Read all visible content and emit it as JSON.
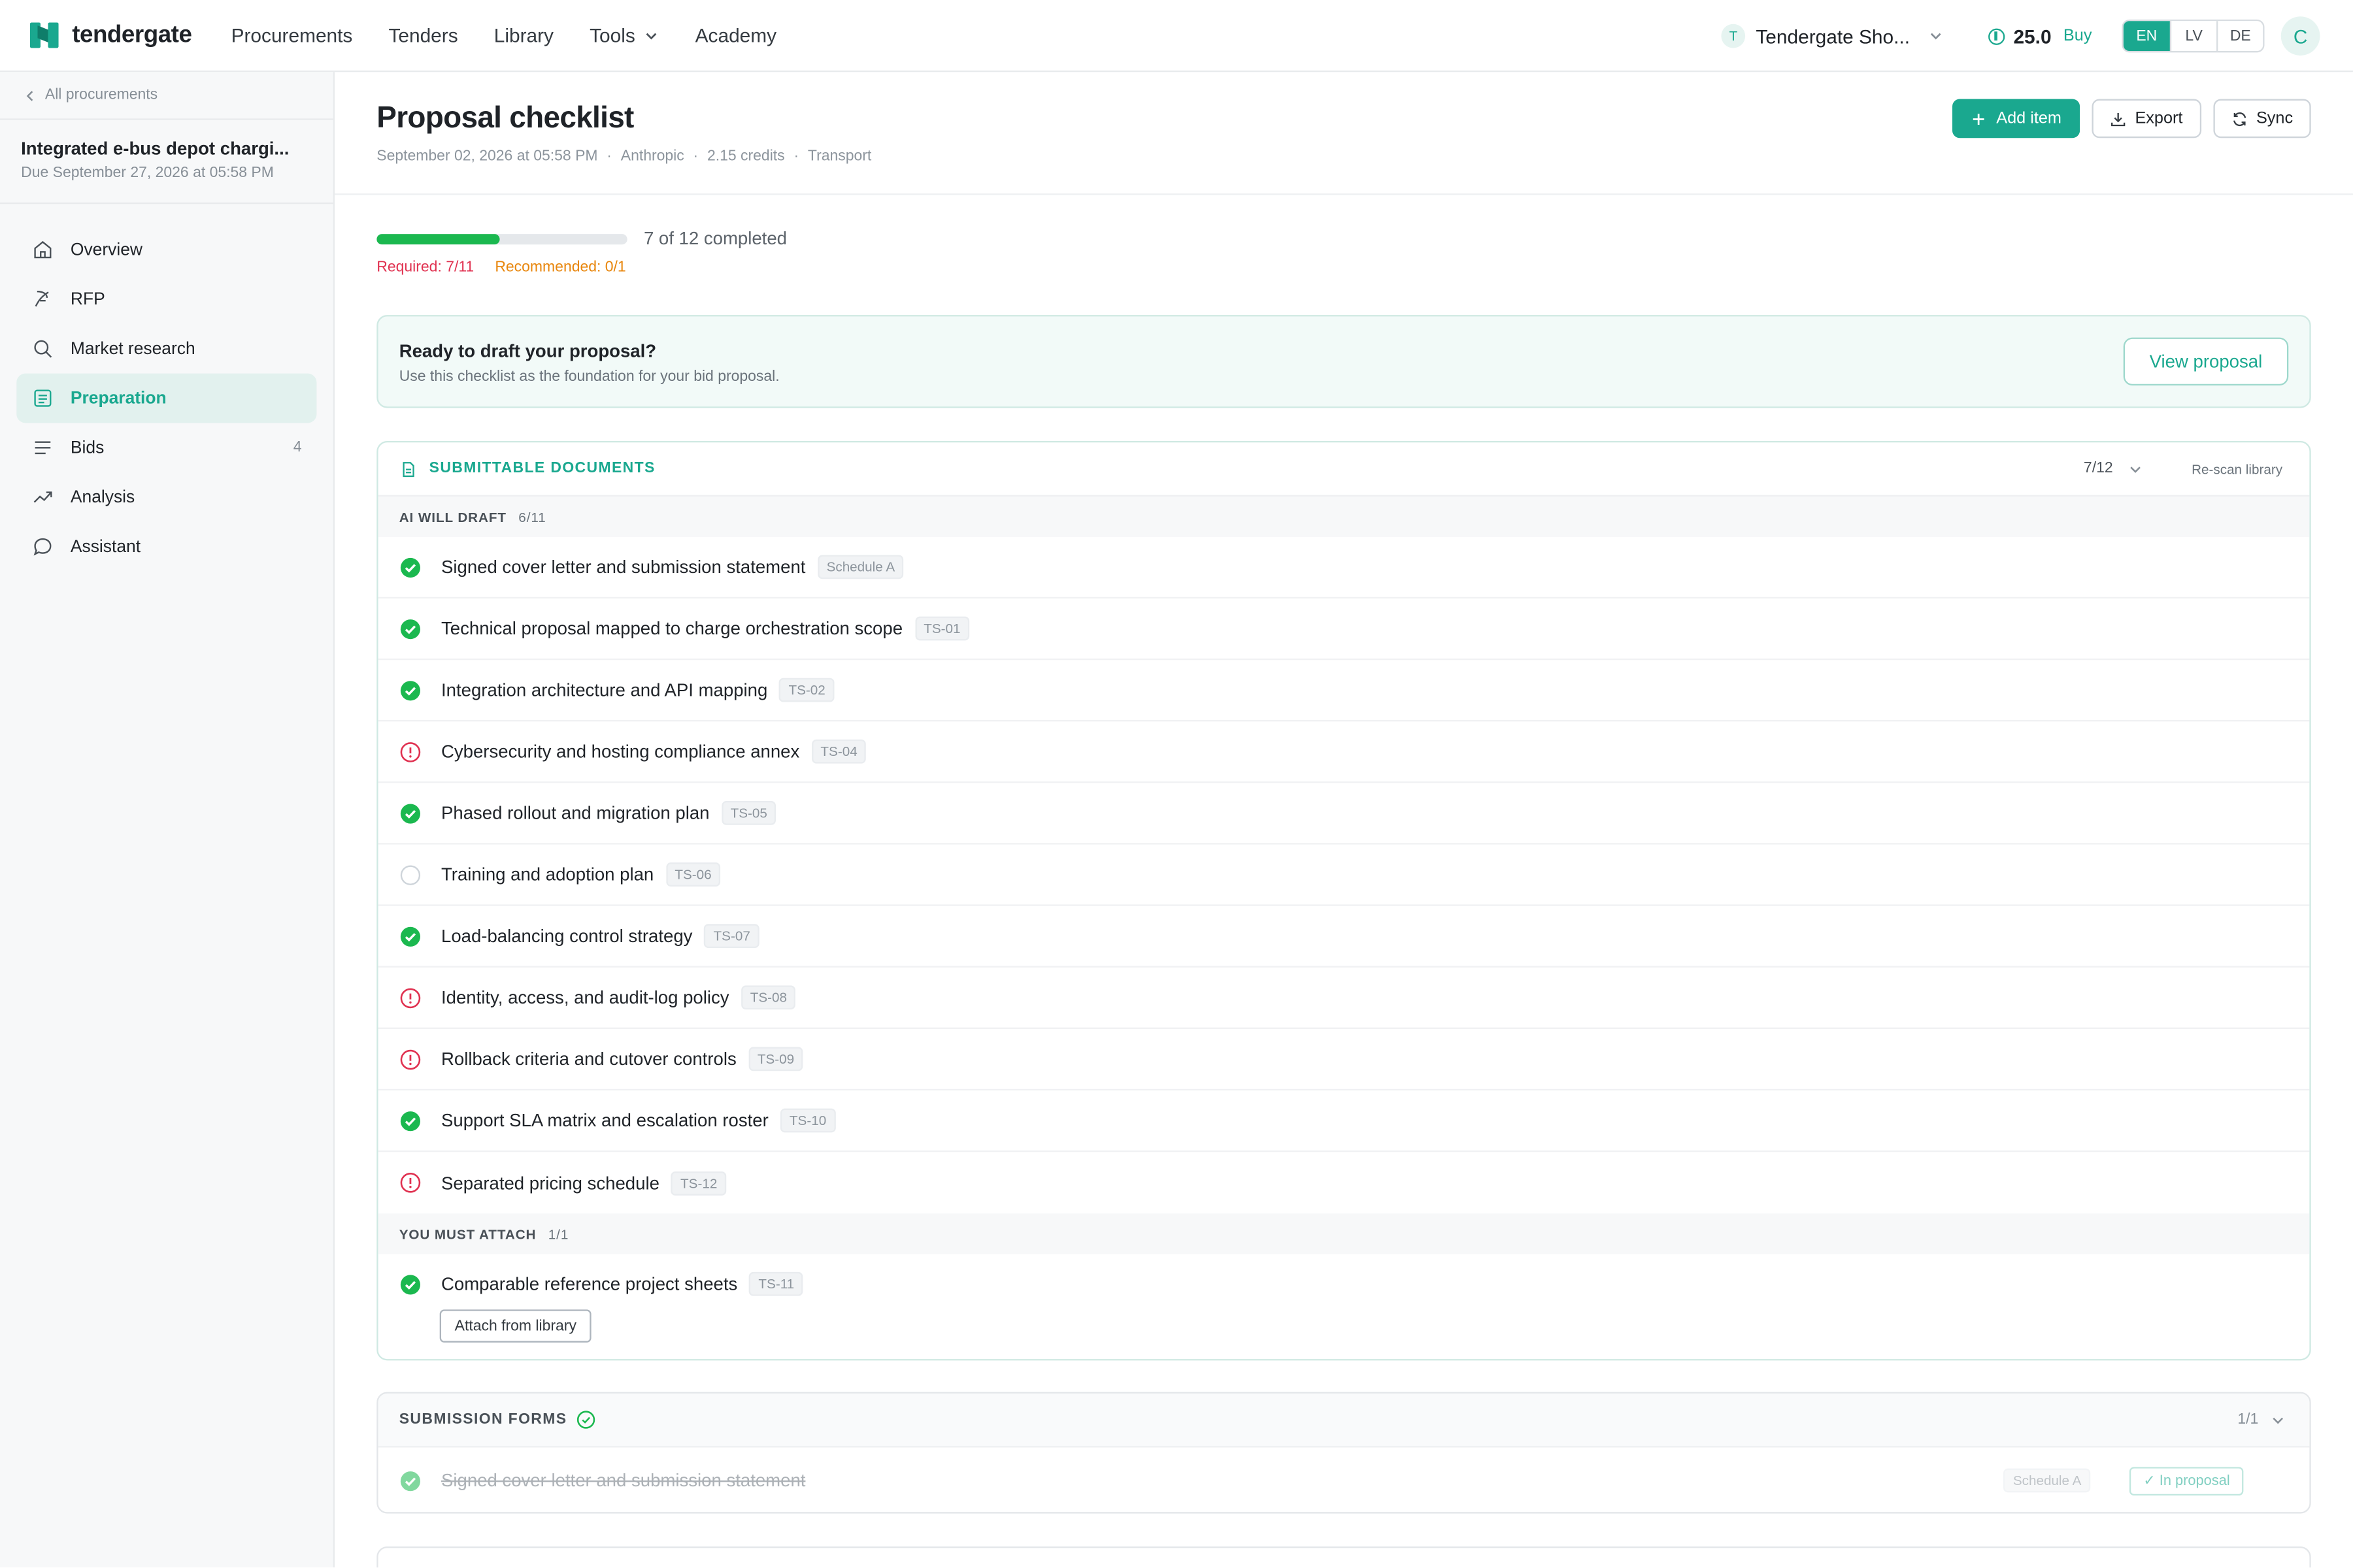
{
  "app": {
    "brand": "tendergate"
  },
  "nav": {
    "items": [
      "Procurements",
      "Tenders",
      "Library",
      "Tools",
      "Academy"
    ]
  },
  "account": {
    "org_initial": "T",
    "org_name": "Tendergate Sho...",
    "credits": "25.0",
    "buy_label": "Buy",
    "languages": [
      "EN",
      "LV",
      "DE"
    ],
    "active_language": "EN",
    "user_initial": "C"
  },
  "sidebar": {
    "back_label": "All procurements",
    "procurement_title": "Integrated e-bus depot chargi...",
    "procurement_due": "Due September 27, 2026 at 05:58 PM",
    "items": [
      {
        "label": "Overview",
        "icon": "home-icon"
      },
      {
        "label": "RFP",
        "icon": "feather-icon"
      },
      {
        "label": "Market research",
        "icon": "search-icon"
      },
      {
        "label": "Preparation",
        "icon": "checklist-icon",
        "active": true
      },
      {
        "label": "Bids",
        "icon": "list-icon",
        "count": "4"
      },
      {
        "label": "Analysis",
        "icon": "trend-icon"
      },
      {
        "label": "Assistant",
        "icon": "chat-icon"
      }
    ]
  },
  "header": {
    "title": "Proposal checklist",
    "meta": [
      "September 02, 2026 at 05:58 PM",
      "Anthropic",
      "2.15 credits",
      "Transport"
    ],
    "add_label": "Add item",
    "export_label": "Export",
    "sync_label": "Sync"
  },
  "progress": {
    "completed": 7,
    "total": 12,
    "text": "7 of 12 completed",
    "required_text": "Required: 7/11",
    "recommended_text": "Recommended: 0/1"
  },
  "banner": {
    "title": "Ready to draft your proposal?",
    "subtitle": "Use this checklist as the foundation for your bid proposal.",
    "button": "View proposal"
  },
  "submittable": {
    "title": "SUBMITTABLE DOCUMENTS",
    "count": "7/12",
    "rescan_label": "Re-scan library",
    "ai_group": {
      "label": "AI WILL DRAFT",
      "count": "6/11"
    },
    "ai_items": [
      {
        "title": "Signed cover letter and submission statement",
        "tag": "Schedule A",
        "status": "done"
      },
      {
        "title": "Technical proposal mapped to charge orchestration scope",
        "tag": "TS-01",
        "status": "done"
      },
      {
        "title": "Integration architecture and API mapping",
        "tag": "TS-02",
        "status": "done"
      },
      {
        "title": "Cybersecurity and hosting compliance annex",
        "tag": "TS-04",
        "status": "missing"
      },
      {
        "title": "Phased rollout and migration plan",
        "tag": "TS-05",
        "status": "done"
      },
      {
        "title": "Training and adoption plan",
        "tag": "TS-06",
        "status": "pending"
      },
      {
        "title": "Load-balancing control strategy",
        "tag": "TS-07",
        "status": "done"
      },
      {
        "title": "Identity, access, and audit-log policy",
        "tag": "TS-08",
        "status": "missing"
      },
      {
        "title": "Rollback criteria and cutover controls",
        "tag": "TS-09",
        "status": "missing"
      },
      {
        "title": "Support SLA matrix and escalation roster",
        "tag": "TS-10",
        "status": "done"
      },
      {
        "title": "Separated pricing schedule",
        "tag": "TS-12",
        "status": "missing"
      }
    ],
    "attach_group": {
      "label": "YOU MUST ATTACH",
      "count": "1/1"
    },
    "attach_item": {
      "title": "Comparable reference project sheets",
      "tag": "TS-11",
      "status": "done",
      "button": "Attach from library"
    }
  },
  "forms": {
    "title": "SUBMISSION FORMS",
    "count": "1/1",
    "item": {
      "title": "Signed cover letter and submission statement",
      "tag": "Schedule A",
      "badge": "In proposal"
    }
  },
  "colors": {
    "accent": "#1aa88f",
    "done": "#1bb84f",
    "missing": "#e03150",
    "recommended": "#e8860c"
  }
}
